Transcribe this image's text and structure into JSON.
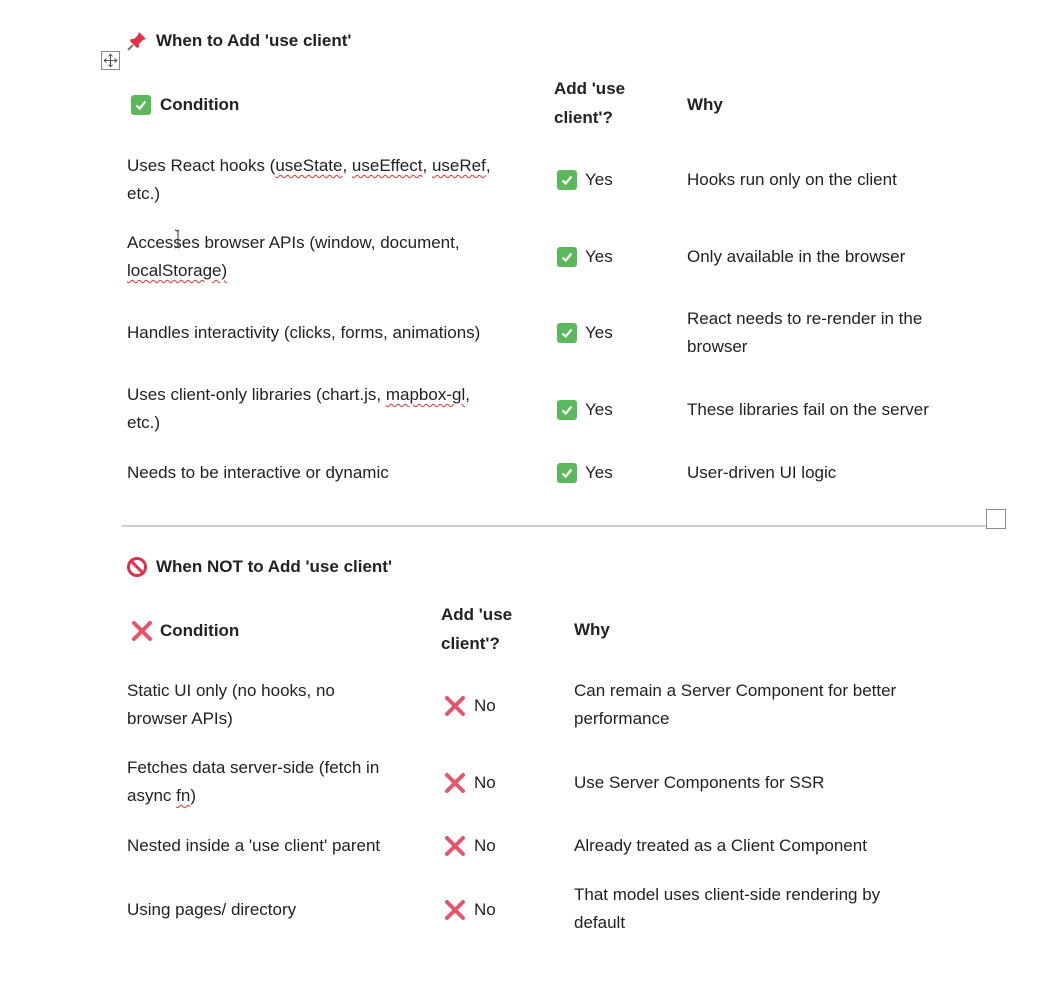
{
  "section1": {
    "title": "When to Add 'use client'",
    "icon": "pushpin-icon",
    "header": {
      "condition": "Condition",
      "add_line1": "Add 'use",
      "add_line2": "client'?",
      "why": "Why"
    },
    "rows": [
      {
        "cond_a": "Uses React hooks (",
        "cond_b": "useState",
        "cond_c": ", ",
        "cond_d": "useEffect",
        "cond_e": ", ",
        "cond_f": "useRef",
        "cond_g": ",",
        "cond_line2": "etc.)",
        "add": "Yes",
        "why": "Hooks run only on the client"
      },
      {
        "cond_line1": "Accesses browser APIs (window, document,",
        "cond_line2": "localStorage)",
        "add": "Yes",
        "why": "Only available in the browser"
      },
      {
        "cond_line1": "Handles interactivity (clicks, forms, animations)",
        "add": "Yes",
        "why_line1": "React needs to re-render in the",
        "why_line2": "browser"
      },
      {
        "cond_a": "Uses client-only libraries (chart.js, ",
        "cond_b": "mapbox-gl",
        "cond_c": ",",
        "cond_line2": "etc.)",
        "add": "Yes",
        "why": "These libraries fail on the server"
      },
      {
        "cond_line1": "Needs to be interactive or dynamic",
        "add": "Yes",
        "why": "User-driven UI logic"
      }
    ]
  },
  "section2": {
    "title": "When NOT to Add 'use client'",
    "icon": "prohibited-icon",
    "header": {
      "condition": "Condition",
      "add_line1": "Add 'use",
      "add_line2": "client'?",
      "why": "Why"
    },
    "rows": [
      {
        "cond_line1": "Static UI only (no hooks, no",
        "cond_line2": "browser APIs)",
        "add": "No",
        "why_line1": "Can remain a Server Component for better",
        "why_line2": "performance"
      },
      {
        "cond_line1": "Fetches data server-side (fetch in",
        "cond_a": "async ",
        "cond_b": "fn",
        "cond_c": ")",
        "add": "No",
        "why": "Use Server Components for SSR"
      },
      {
        "cond_line1": "Nested inside a 'use client' parent",
        "add": "No",
        "why": "Already treated as a Client Component"
      },
      {
        "cond_line1": "Using pages/ directory",
        "add": "No",
        "why_line1": "That model uses client-side rendering by",
        "why_line2": "default"
      }
    ]
  },
  "colors": {
    "check_green": "#5cb85c",
    "x_red": "#e8546b",
    "pin_red": "#e0314b",
    "prohibit_red": "#e0314b",
    "rule_gray": "#cfcfcf",
    "spell_red": "#dd3333"
  }
}
